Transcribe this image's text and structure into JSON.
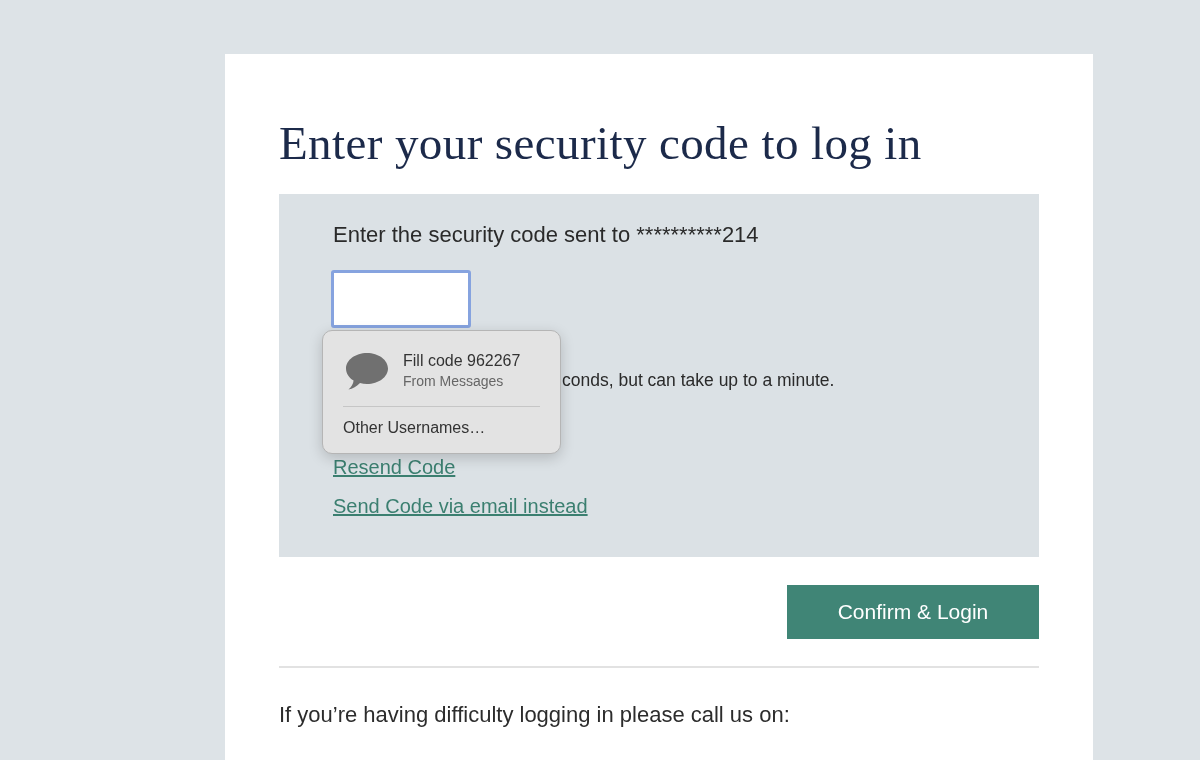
{
  "title": "Enter your security code to log in",
  "verification": {
    "prompt": "Enter the security code sent to **********214",
    "code_field": {
      "focused": true
    },
    "hint": "conds, but can take up to a minute.",
    "links": [
      "Resend Code",
      "Send Code via email instead"
    ]
  },
  "autofill_popup": {
    "suggestion": {
      "title": "Fill code 962267",
      "source": "From Messages"
    },
    "other_option": "Other Usernames…"
  },
  "confirm_button": "Confirm & Login",
  "help_text": "If you’re having difficulty logging in please call us on:"
}
